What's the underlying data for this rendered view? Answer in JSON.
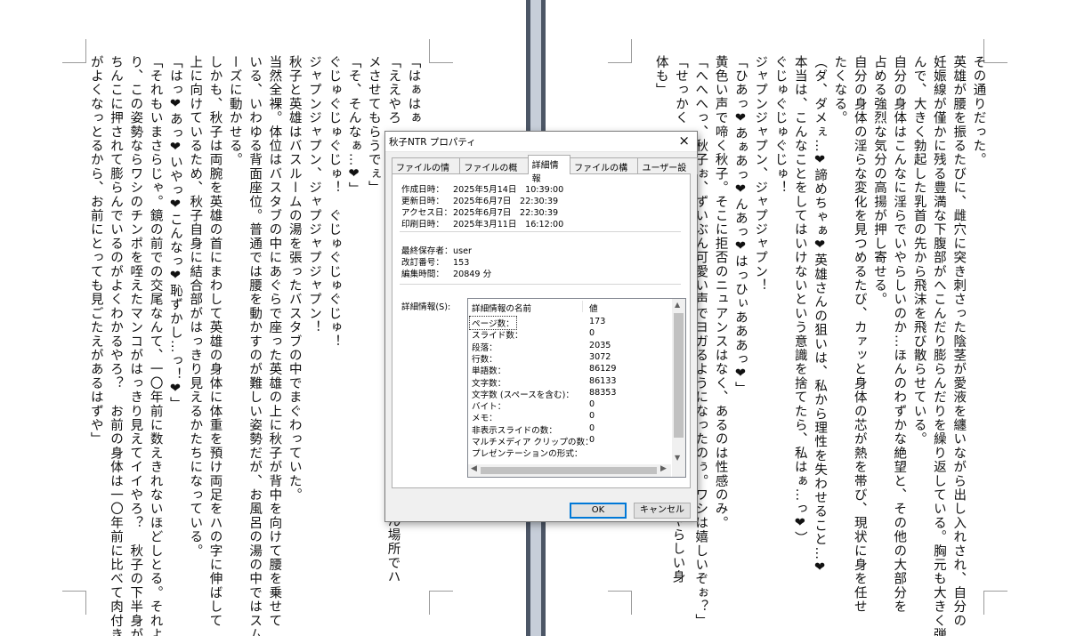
{
  "document": {
    "right_page_columns": [
      "その通りだった。",
      "英雄が腰を振るたびに、雌穴に突き刺さった陰茎が愛液を纏いながら出し入れされ、自分の",
      "妊娠線が僅かに残る豊満な下腹部がへこんだり膨らんだりを繰り返している。胸元も大きく弾",
      "んで、大きく勃起した乳首の先から飛沫を飛び散らせている。",
      "自分の身体はこんなに淫らでいやらしいのか…ほんのわずかな絶望と、その他の大部分を",
      "占める強烈な気分の高揚が押し寄せる。",
      "自分の身体の淫らな変化を見つめるたび、カァッと身体の芯が熱を帯び、現状に身を任せ",
      "たくなる。",
      "（ダ、ダメぇ…❤諦めちゃぁ❤英雄さんの狙いは、私から理性を失わせること…❤",
      "本当は、こんなことをしてはいけないという意識を捨てたら、私はぁ…っ❤）",
      "ぐじゅぐじゅぐじゅ！",
      "ジャプンジャプン、ジャプジャプン！",
      "「ひあっ❤あぁあっ❤んあっ❤はっひぃあああっ❤」",
      "黄色い声で啼く秋子。そこに拒否のニュアンスはなく、あるのは性感のみ。",
      "「へへへっ、秋子ぉ、ずいぶん可愛い声でヨガるようになったのぅ。ワシは嬉しいぞぉ？」",
      "「せっかく",
      "体も」"
    ],
    "right_page_partial": "やらしい身",
    "left_page_columns": [
      "「はぁはぁ",
      "「ええやろ",
      "メさせてもらうでぇ」",
      "「そ、そんなぁ…❤」",
      "ぐじゅぐじゅぐじゅ！　ぐじゅぐじゅぐじゅ！",
      "ジャプンジャプン、ジャプジャプジャプン！",
      "秋子と英雄はバスルームの湯を張ったバスタブの中でまぐわっていた。",
      "当然全裸。体位はバスタブの中にあぐらで座った英雄の上に秋子が背中を向けて腰を乗せて",
      "いる、いわゆる背面座位。普通では腰を動かすのが難しい姿勢だが、お風呂の湯の中ではスム",
      "ーズに動かせる。",
      "しかも、秋子は両腕を英雄の首にまわして英雄の身体に体重を預け両足をハの字に伸ばして",
      "上に向けているため、秋子自身に結合部がはっきり見えるかたちになっている。",
      "「はっ❤あっ❤いやっ❤こんなっ❤恥ずかし…っ！❤」",
      "「それもいまさらじゃ。鏡の前での交尾なんて、一〇年前に数えきれないほどしとる。それよ",
      "り、この姿勢ならワシのチンポを咥えたマンコがはっきり見えてイイやろ？　秋子の下半身が",
      "ちんこに押されて膨らんでいるのがよくわかるやろ？　お前の身体は一〇年前に比べて肉付き",
      "がよくなっとるから、お前にとっても見ごたえがあるはずや」"
    ],
    "left_page_partial": "ん場所でハ"
  },
  "dialog": {
    "title": "秋子NTR プロパティ",
    "close_label": "×",
    "tabs": [
      "ファイルの情報",
      "ファイルの概要",
      "詳細情報",
      "ファイルの構成",
      "ユーザー設定"
    ],
    "active_tab": "詳細情報",
    "dates": [
      {
        "label": "作成日時：",
        "value": "2025年5月14日　10:39:00"
      },
      {
        "label": "更新日時：",
        "value": "2025年6月7日　22:30:39"
      },
      {
        "label": "アクセス日：",
        "value": "2025年6月7日　22:30:39"
      },
      {
        "label": "印刷日時：",
        "value": "2025年3月11日　16:12:00"
      }
    ],
    "meta": [
      {
        "label": "最終保存者：",
        "value": "user"
      },
      {
        "label": "改訂番号：",
        "value": "153"
      },
      {
        "label": "編集時間：",
        "value": "20849 分"
      }
    ],
    "details_label": "詳細情報(S):",
    "list_header": {
      "name": "詳細情報の名前",
      "value": "値"
    },
    "stats": [
      {
        "name": "ページ数：",
        "value": "173"
      },
      {
        "name": "スライド数：",
        "value": "0"
      },
      {
        "name": "段落：",
        "value": "2035"
      },
      {
        "name": "行数：",
        "value": "3072"
      },
      {
        "name": "単語数：",
        "value": "86129"
      },
      {
        "name": "文字数：",
        "value": "86133"
      },
      {
        "name": "文字数 (スペースを含む)：",
        "value": "88353"
      },
      {
        "name": "バイト：",
        "value": "0"
      },
      {
        "name": "メモ：",
        "value": "0"
      },
      {
        "name": "非表示スライドの数：",
        "value": "0"
      },
      {
        "name": "マルチメディア クリップの数：",
        "value": "0"
      },
      {
        "name": "プレゼンテーションの形式：",
        "value": ""
      }
    ],
    "ok_label": "OK",
    "cancel_label": "キャンセル"
  },
  "colors": {
    "page_gap": "#c7ced9",
    "page_gap_edge": "#4c5666",
    "dialog_bg": "#f0f0f0",
    "ok_border": "#0078d7"
  }
}
